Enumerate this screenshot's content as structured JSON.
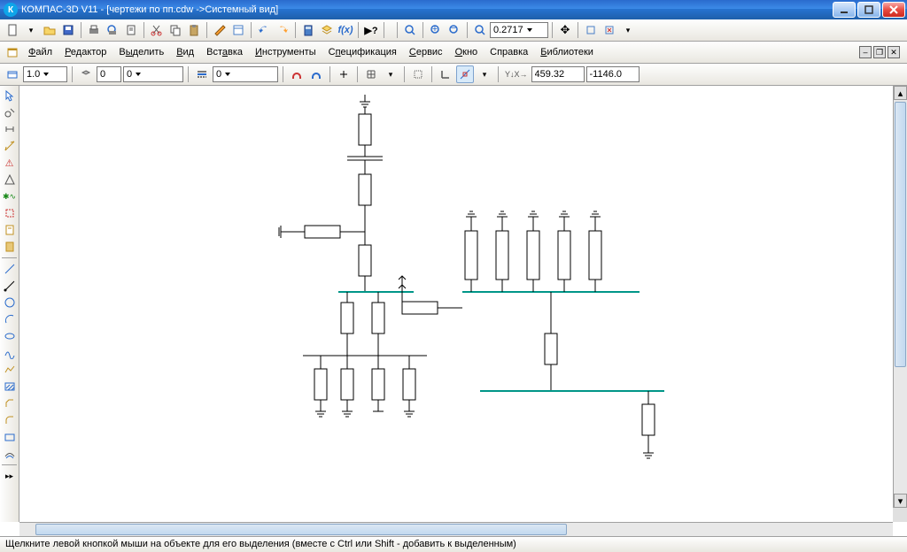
{
  "title": "КОМПАС-3D V11 - [чертежи по пп.cdw ->Системный вид]",
  "toolbar1": {
    "zoom_value": "0.2717"
  },
  "menu": {
    "file": "Файл",
    "editor": "Редактор",
    "select": "Выделить",
    "view": "Вид",
    "insert": "Вставка",
    "tools": "Инструменты",
    "spec": "Спецификация",
    "service": "Сервис",
    "window": "Окно",
    "help": "Справка",
    "libs": "Библиотеки"
  },
  "propbar": {
    "scale": "1.0",
    "layer_num": "0",
    "layer_sel": "0",
    "coord_x": "459.32",
    "coord_y": "-1146.0"
  },
  "status": "Щелкните левой кнопкой мыши на объекте для его выделения (вместе с Ctrl или Shift - добавить к выделенным)",
  "coord_label": "Y↓X→"
}
